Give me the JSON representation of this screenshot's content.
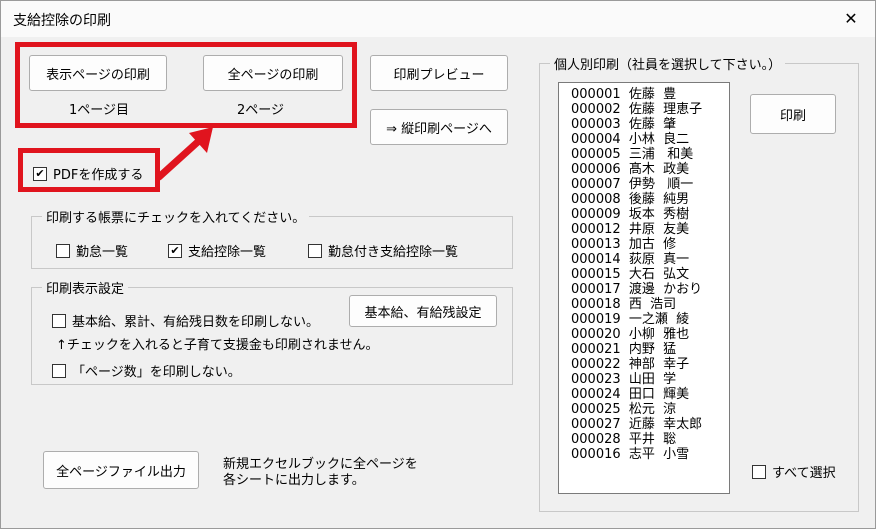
{
  "window": {
    "title": "支給控除の印刷",
    "close": "✕"
  },
  "buttons": {
    "print_current": "表示ページの印刷",
    "print_all": "全ページの印刷",
    "preview": "印刷プレビュー",
    "vertical": "⇒ 縦印刷ページへ",
    "print_individual": "印刷",
    "base_pay_setting": "基本給、有給残設定",
    "export_all": "全ページファイル出力"
  },
  "labels": {
    "page_current": "1ページ目",
    "page_total": "2ページ",
    "export_note_1": "新規エクセルブックに全ページを",
    "export_note_2": "各シートに出力します。",
    "note_arrow": "↑チェックを入れると子育て支援金も印刷されません。"
  },
  "pdf_checkbox": {
    "label": "PDFを作成する",
    "checked": true
  },
  "group_forms": {
    "legend": "印刷する帳票にチェックを入れてください。",
    "items": [
      {
        "label": "勤怠一覧",
        "checked": false
      },
      {
        "label": "支給控除一覧",
        "checked": true
      },
      {
        "label": "勤怠付き支給控除一覧",
        "checked": false
      }
    ]
  },
  "group_display": {
    "legend": "印刷表示設定",
    "no_print_base": {
      "label": "基本給、累計、有給残日数を印刷しない。",
      "checked": false
    },
    "no_page_num": {
      "label": "「ページ数」を印刷しない。",
      "checked": false
    }
  },
  "group_individual": {
    "legend": "個人別印刷（社員を選択して下さい。）",
    "employees": [
      "000001  佐藤  豊",
      "000002  佐藤  理恵子",
      "000003  佐藤  肇",
      "000004  小林  良二",
      "000005  三浦   和美",
      "000006  髙木  政美",
      "000007  伊勢   順一",
      "000008  後藤  純男",
      "000009  坂本  秀樹",
      "000012  井原  友美",
      "000013  加古  修",
      "000014  荻原  真一",
      "000015  大石  弘文",
      "000017  渡邊  かおり",
      "000018  西  浩司",
      "000019  一之瀬  綾",
      "000020  小柳  雅也",
      "000021  内野  猛",
      "000022  神部  幸子",
      "000023  山田  学",
      "000024  田口  輝美",
      "000025  松元  涼",
      "000027  近藤  幸太郎",
      "000028  平井  聡",
      "000016  志平  小雪"
    ],
    "select_all": {
      "label": "すべて選択",
      "checked": false
    }
  },
  "colors": {
    "highlight_red": "#e0141e"
  }
}
